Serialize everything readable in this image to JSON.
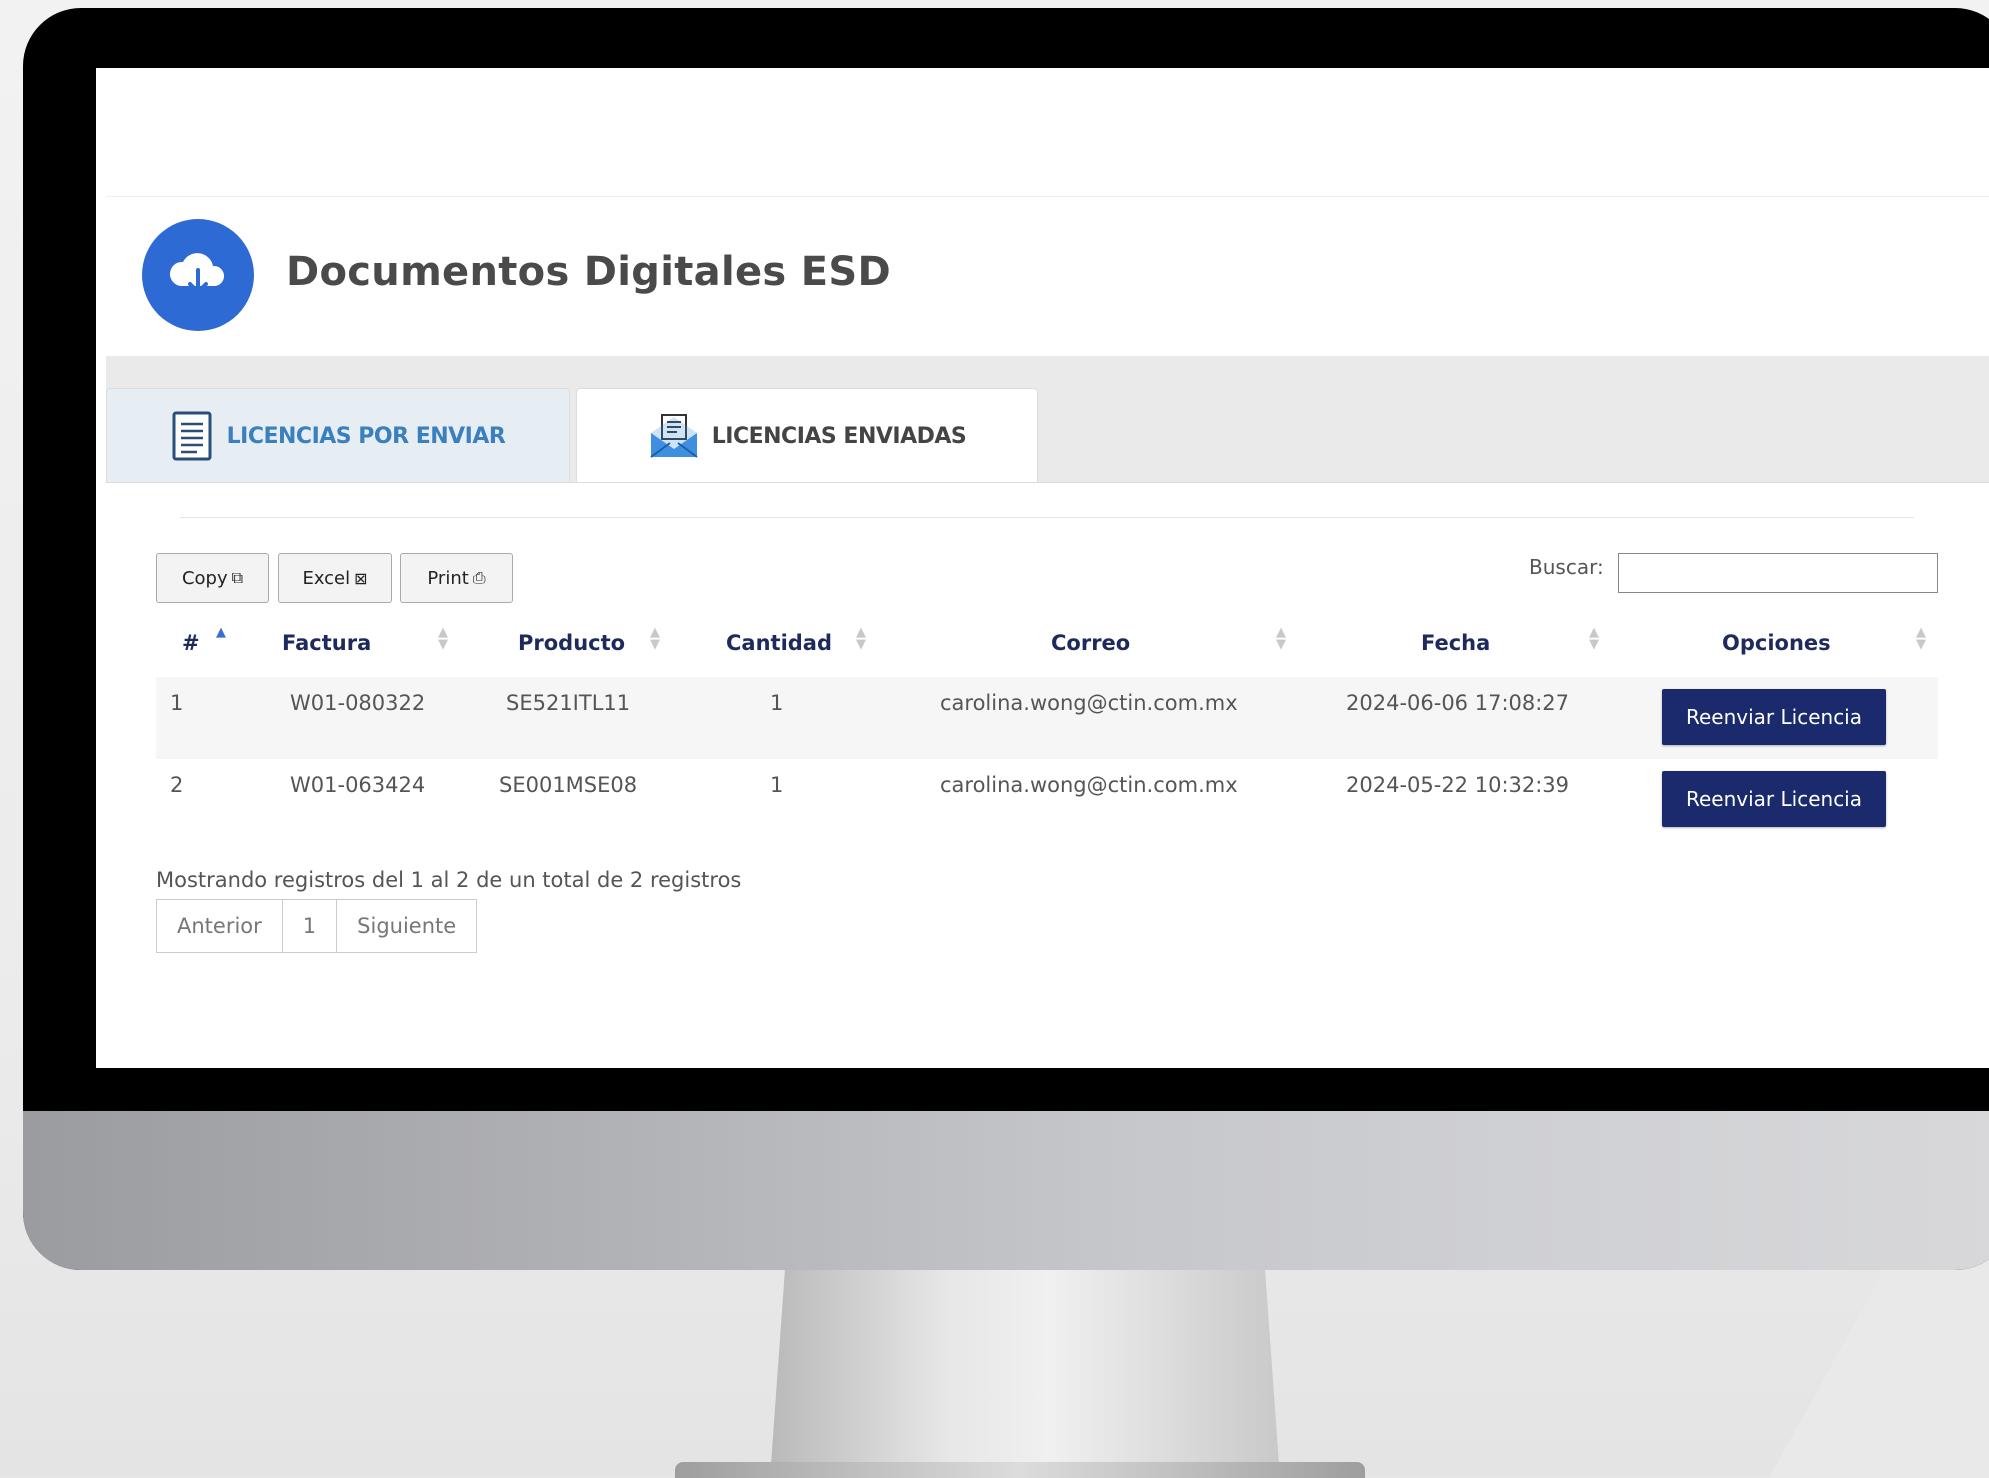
{
  "header": {
    "title": "Documentos Digitales ESD",
    "logo_icon": "cloud-download-icon",
    "accent_color": "#2d6ad3"
  },
  "tabs": [
    {
      "label": "LICENCIAS POR ENVIAR",
      "icon": "document-icon",
      "active": false
    },
    {
      "label": "LICENCIAS ENVIADAS",
      "icon": "open-envelope-icon",
      "active": true
    }
  ],
  "toolbar": {
    "copy_label": "Copy",
    "excel_label": "Excel",
    "print_label": "Print"
  },
  "search": {
    "label": "Buscar:",
    "value": ""
  },
  "table": {
    "columns": [
      "#",
      "Factura",
      "Producto",
      "Cantidad",
      "Correo",
      "Fecha",
      "Opciones"
    ],
    "rows": [
      {
        "num": "1",
        "factura": "W01-080322",
        "producto": "SE521ITL11",
        "cantidad": "1",
        "correo": "carolina.wong@ctin.com.mx",
        "fecha": "2024-06-06 17:08:27",
        "accion": "Reenviar Licencia"
      },
      {
        "num": "2",
        "factura": "W01-063424",
        "producto": "SE001MSE08",
        "cantidad": "1",
        "correo": "carolina.wong@ctin.com.mx",
        "fecha": "2024-05-22 10:32:39",
        "accion": "Reenviar Licencia"
      }
    ]
  },
  "footer": {
    "info": "Mostrando registros del 1 al 2 de un total de 2 registros",
    "pagination": {
      "previous": "Anterior",
      "current": "1",
      "next": "Siguiente"
    }
  },
  "colors": {
    "button_primary": "#1a2a6c",
    "header_text": "#1f2a5c"
  }
}
